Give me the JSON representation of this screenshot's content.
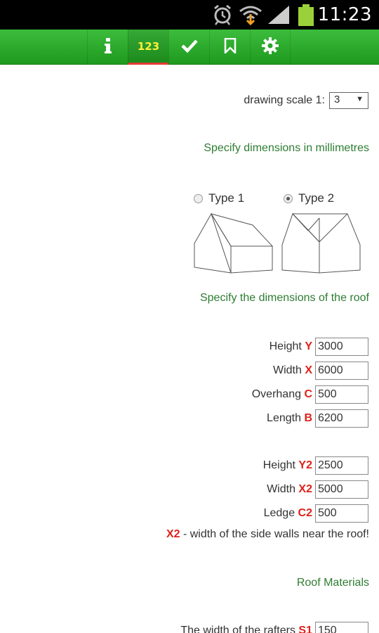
{
  "status_bar": {
    "time": "11:23",
    "icons": [
      "alarm-icon",
      "wifi-icon",
      "signal-icon",
      "battery-icon"
    ],
    "battery_color": "#9ad13a"
  },
  "toolbar": {
    "accent": "#2aae2a",
    "tabs": [
      {
        "icon": "info-icon",
        "label": ""
      },
      {
        "icon": "",
        "label": "123",
        "active": true
      },
      {
        "icon": "check-icon",
        "label": ""
      },
      {
        "icon": "bookmark-icon",
        "label": ""
      },
      {
        "icon": "gear-icon",
        "label": ""
      }
    ]
  },
  "scale": {
    "label": "drawing scale 1:",
    "value": "3"
  },
  "specify_mm": "Specify dimensions in millimetres",
  "types": {
    "type1": {
      "label": "Type 1",
      "checked": false
    },
    "type2": {
      "label": "Type 2",
      "checked": true
    }
  },
  "specify_roof": "Specify the dimensions of the roof",
  "fields1": [
    {
      "label": "Height",
      "var": "Y",
      "value": "3000"
    },
    {
      "label": "Width",
      "var": "X",
      "value": "6000"
    },
    {
      "label": "Overhang",
      "var": "C",
      "value": "500"
    },
    {
      "label": "Length",
      "var": "B",
      "value": "6200"
    }
  ],
  "fields2": [
    {
      "label": "Height",
      "var": "Y2",
      "value": "2500"
    },
    {
      "label": "Width",
      "var": "X2",
      "value": "5000"
    },
    {
      "label": "Ledge",
      "var": "C2",
      "value": "500"
    }
  ],
  "note": {
    "var": "X2",
    "text": " - width of the side walls near the roof!"
  },
  "roof_materials": "Roof Materials",
  "rafters": {
    "label": "The width of the rafters",
    "var": "S1",
    "value": "150"
  }
}
